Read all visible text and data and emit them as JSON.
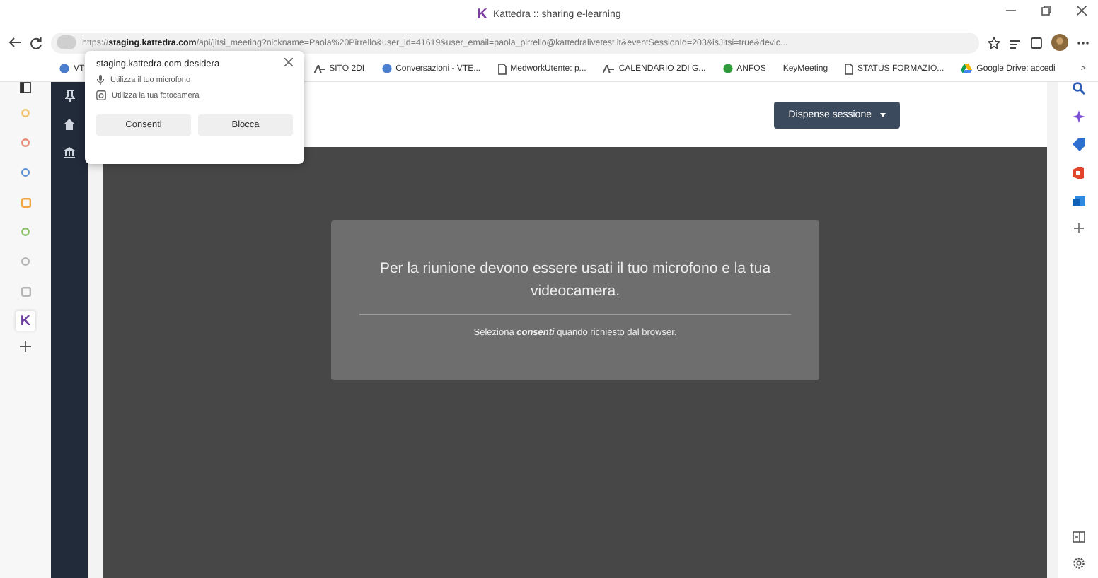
{
  "window": {
    "logo": "K",
    "title": "Kattedra :: sharing e-learning"
  },
  "address_bar": {
    "url": "https://**staging.kattedra.com**/api/jitsi_meeting?nickname=Paola%20Pirrello&user_id=41619&user_email=paola_pirrello@kattedralivetest.it&eventSessionId=203&isJitsi=true&devic..."
  },
  "bookmarks": [
    {
      "label": "VT",
      "kind": "globe"
    },
    {
      "label": "SITO 2DI",
      "kind": "logo"
    },
    {
      "label": "Conversazioni - VTE...",
      "kind": "globe"
    },
    {
      "label": "MedworkUtente: p...",
      "kind": "page"
    },
    {
      "label": "CALENDARIO 2DI G...",
      "kind": "logo"
    },
    {
      "label": "ANFOS",
      "kind": "green"
    },
    {
      "label": "KeyMeeting",
      "kind": "none"
    },
    {
      "label": "STATUS FORMAZIO...",
      "kind": "page"
    },
    {
      "label": "Google Drive: accedi",
      "kind": "drive"
    }
  ],
  "bookmarks_more": ">",
  "permission_popup": {
    "title": "staging.kattedra.com desidera",
    "requests": [
      {
        "kind": "microphone",
        "label": "Utilizza il tuo microfono"
      },
      {
        "kind": "camera",
        "label": "Utilizza la tua fotocamera"
      }
    ],
    "buttons": [
      "Consenti",
      "Blocca"
    ]
  },
  "side_apps": [
    {
      "kind": "dot",
      "color": "#f0c36b",
      "selected": false
    },
    {
      "kind": "dot",
      "color": "#e88a7a",
      "selected": false
    },
    {
      "kind": "dot",
      "color": "#5b8fd6",
      "selected": false
    },
    {
      "kind": "square",
      "color": "#f2a541",
      "selected": false
    },
    {
      "kind": "dot",
      "color": "#8cc26b",
      "selected": false
    },
    {
      "kind": "dot",
      "color": "#b5b5b5",
      "selected": false
    },
    {
      "kind": "square",
      "color": "#b5b5b5",
      "selected": false
    },
    {
      "kind": "letter",
      "label": "K",
      "selected": true
    }
  ],
  "header": {
    "button": "Dispense sessione"
  },
  "notice": {
    "message": "Per la riunione devono essere usati il tuo microfono e la tua videocamera.",
    "hint": "Seleziona **consenti** quando richiesto dal browser."
  }
}
